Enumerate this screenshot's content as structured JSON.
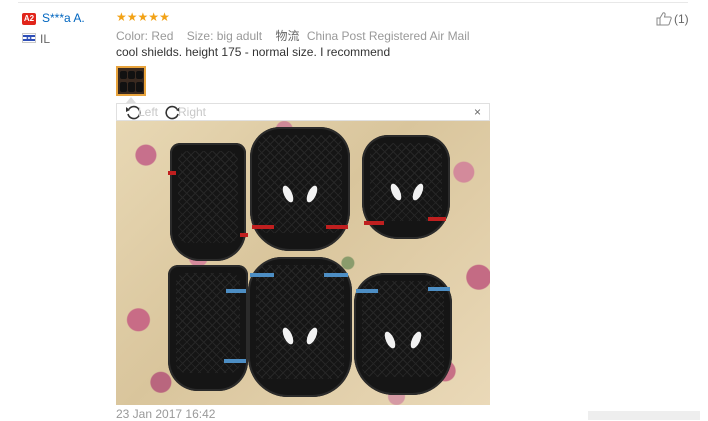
{
  "reviewer": {
    "badge": "A2",
    "name": "S***a A.",
    "country": "IL",
    "flag_icon": "israel-flag-icon"
  },
  "review": {
    "stars": [
      "★",
      "★",
      "★",
      "★",
      "★"
    ],
    "rating_color": "#f2a216",
    "color_label": "Color:",
    "color_value": "Red",
    "size_label": "Size:",
    "size_value": "big adult",
    "shipping_label": "物流",
    "shipping_value": "China Post Registered Air Mail",
    "text": "cool shields. height 175 - normal size. I recommend",
    "timestamp": "23 Jan 2017 16:42"
  },
  "helpful": {
    "icon": "thumbs-up-icon",
    "count": "(1)"
  },
  "viewer": {
    "rotate_left_label": "Left",
    "rotate_right_label": "Right",
    "close_label": "×"
  }
}
